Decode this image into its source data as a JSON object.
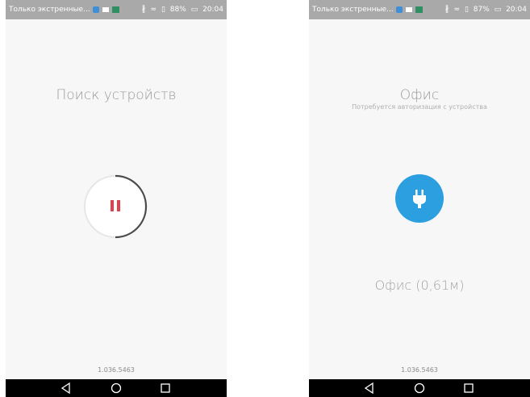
{
  "screens": [
    {
      "status": {
        "notice": "Только экстренные...",
        "battery": "88%",
        "time": "20:04"
      },
      "title": "Поиск устройств",
      "version": "1.036.5463",
      "pause_color": "#e0424b"
    },
    {
      "status": {
        "notice": "Только экстренные...",
        "battery": "87%",
        "time": "20:04"
      },
      "title": "Офис",
      "subtitle": "Потребуется авторизация с устройства",
      "device": "Офис (0,61м)",
      "version": "1.036.5463",
      "accent": "#2b9fe0"
    }
  ],
  "icons": {
    "status_left": [
      "location-icon",
      "message-icon",
      "photo-icon"
    ],
    "status_right": [
      "bluetooth-icon",
      "wifi-icon",
      "sim-icon",
      "battery-icon"
    ],
    "nav": [
      "back-icon",
      "home-icon",
      "recent-apps-icon"
    ]
  }
}
